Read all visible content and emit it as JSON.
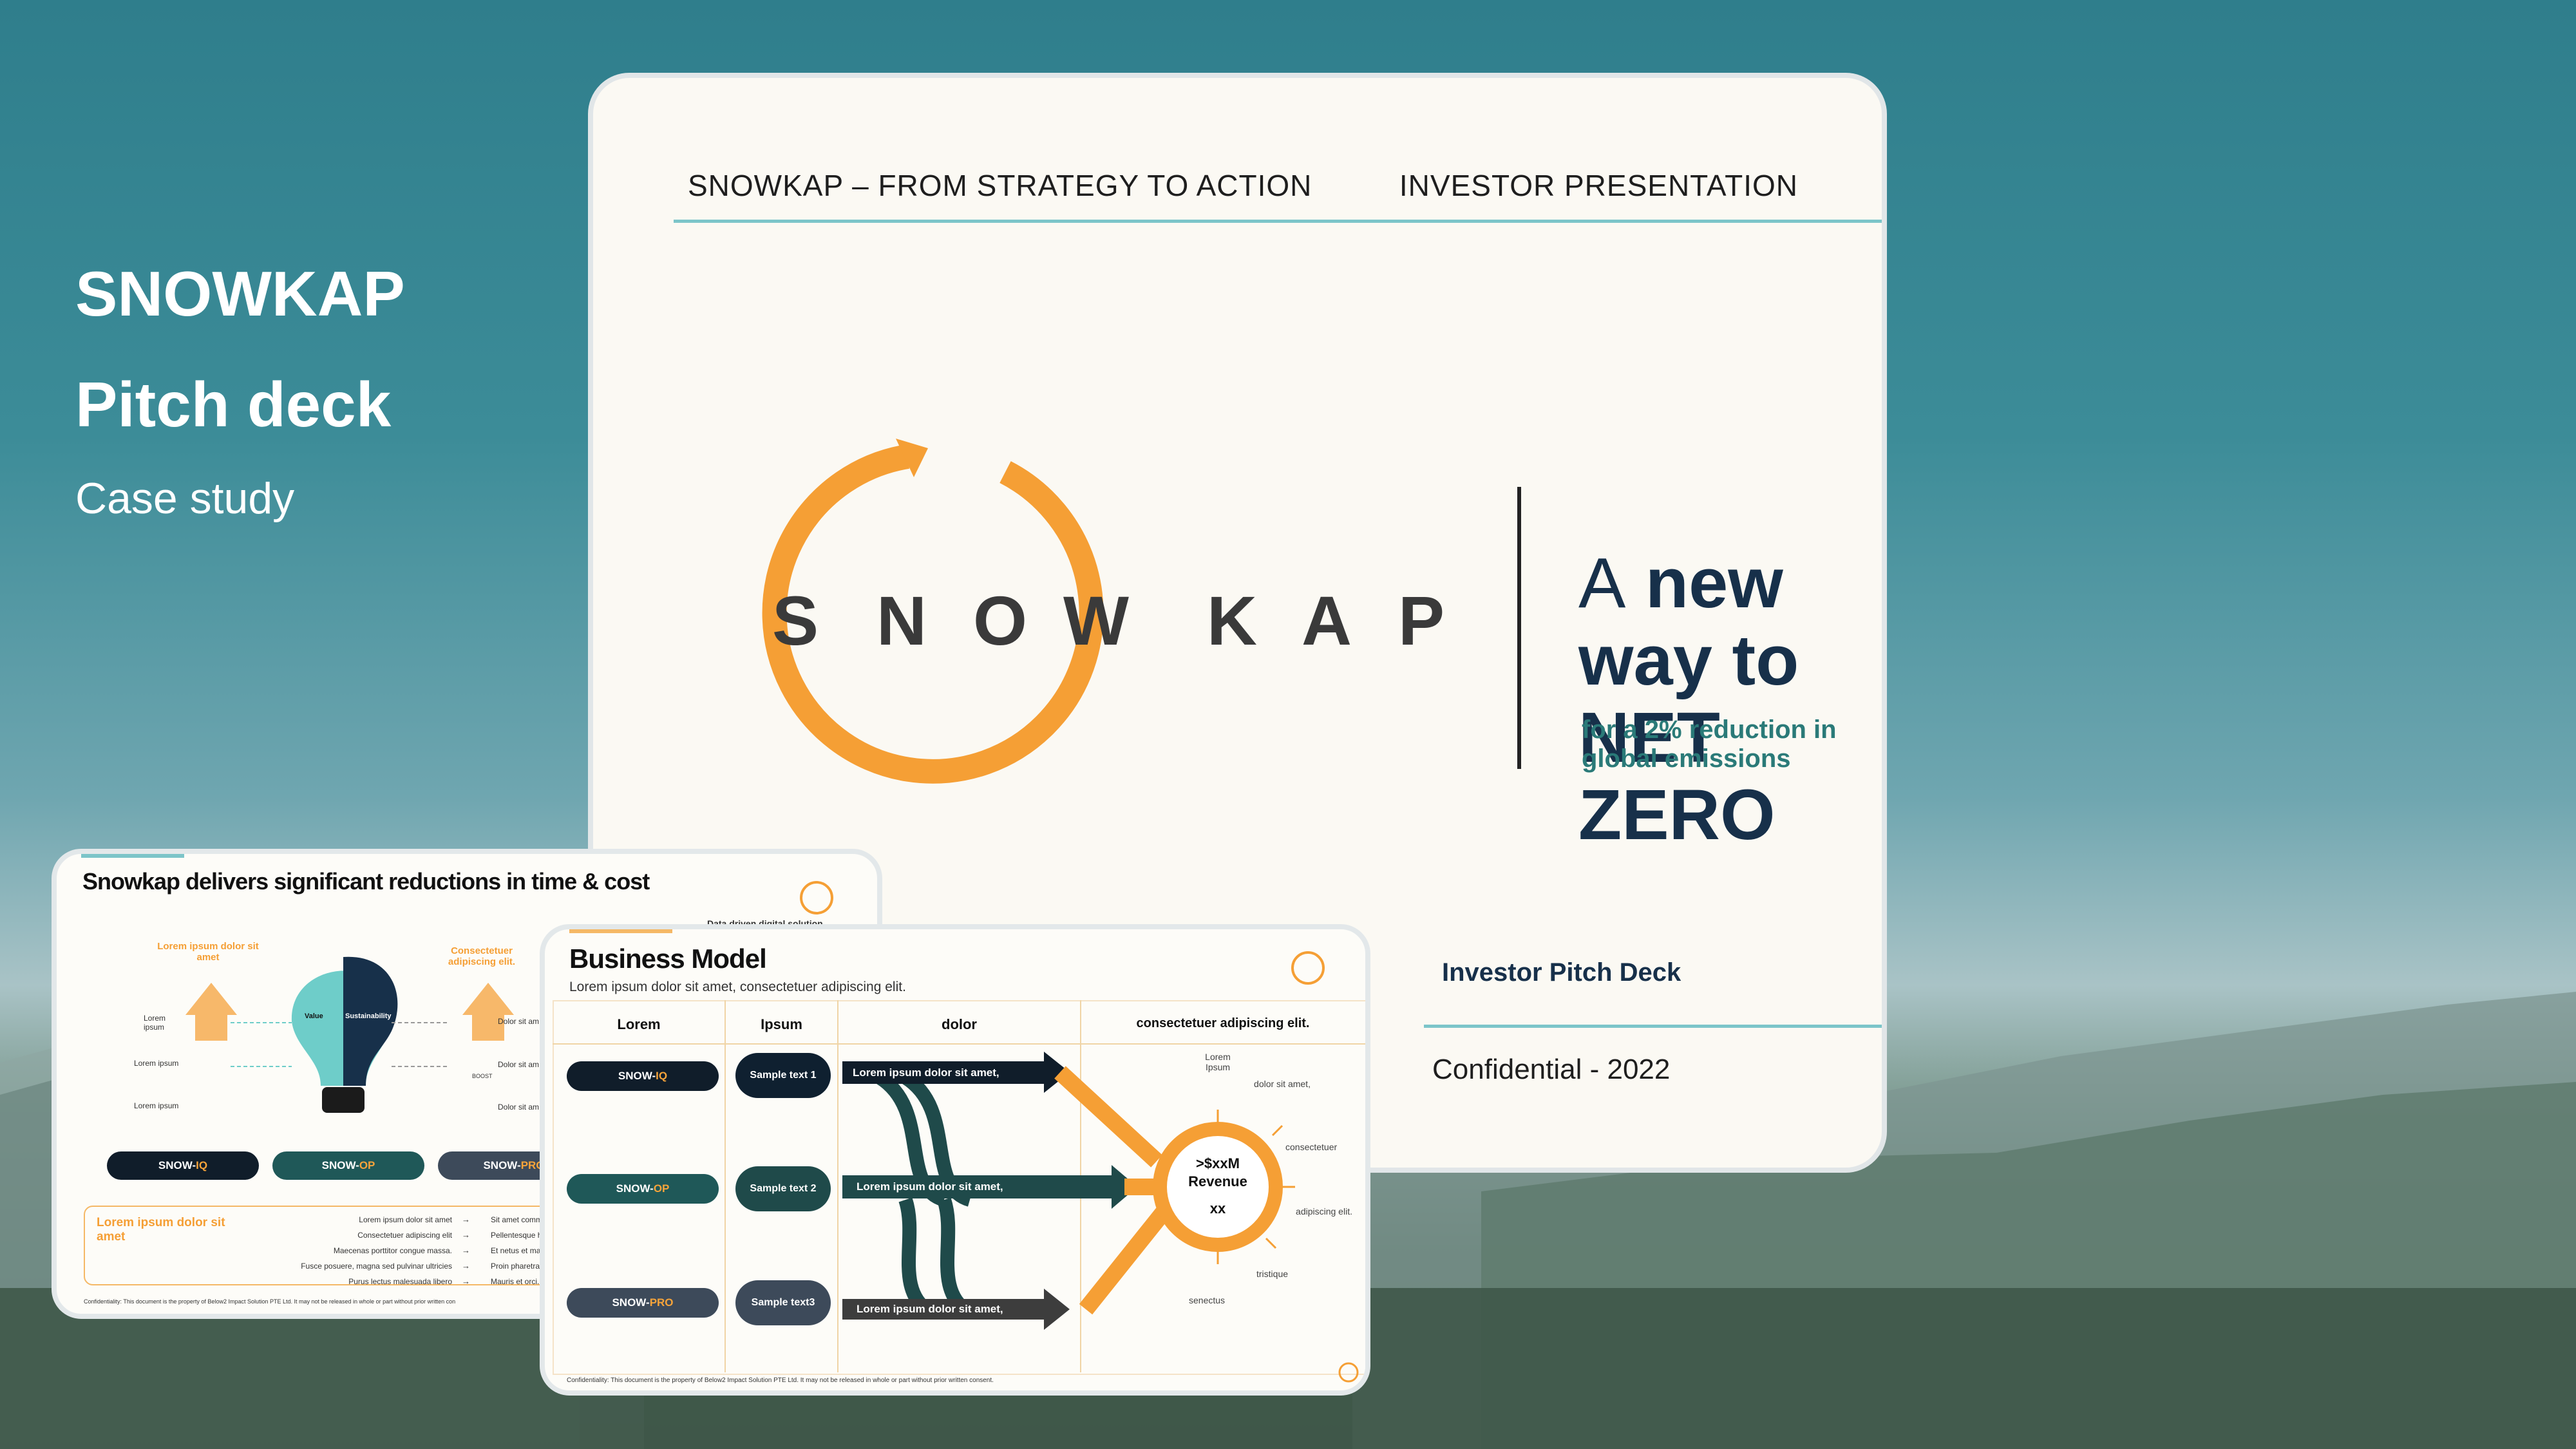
{
  "hero": {
    "title_line1": "SNOWKAP",
    "title_line2": "Pitch deck",
    "subtitle": "Case study"
  },
  "main_slide": {
    "header_left": "SNOWKAP –  FROM STRATEGY TO ACTION",
    "header_right": "INVESTOR PRESENTATION",
    "logo_letters": [
      "S",
      "N",
      "O",
      "W",
      "K",
      "A",
      "P"
    ],
    "tagline_a": "A",
    "tagline_rest_1": " new way to NET",
    "tagline_line2": "ZERO",
    "tagline_sub": "for a 2% reduction in global emissions",
    "footer_title": "Investor Pitch Deck",
    "confidential": "Confidential - 2022",
    "accent_orange": "#f59f35",
    "accent_teal": "#7cc5c9"
  },
  "slide_reductions": {
    "title": "Snowkap delivers significant reductions in time & cost",
    "top_right_text": "Data driven digital solution",
    "left_arrow_label": "Lorem ipsum dolor sit amet",
    "right_arrow_label": "Consectetuer adipiscing elit.",
    "left_items": [
      "Lorem ipsum",
      "Lorem ipsum",
      "Lorem ipsum"
    ],
    "right_items": [
      "Dolor sit am",
      "Dolor sit am",
      "Dolor sit am"
    ],
    "bulb_left": "Value",
    "bulb_right": "Sustainability",
    "boost_label": "BOOST",
    "pills": [
      {
        "prefix": "SNOW-",
        "suffix": "IQ"
      },
      {
        "prefix": "SNOW-",
        "suffix": "OP"
      },
      {
        "prefix": "SNOW-",
        "suffix": "PRO"
      }
    ],
    "box_heading": "Lorem ipsum dolor sit amet",
    "box_left": [
      "Lorem ipsum dolor sit amet",
      "Consectetuer adipiscing elit",
      "Maecenas porttitor congue massa.",
      "Fusce posuere, magna sed pulvinar ultricies",
      "Purus lectus malesuada libero"
    ],
    "box_right": [
      "Sit amet commodo m",
      "Pellentesque habita",
      "Et netus et malesua",
      "Proin pharetra nonu",
      "Mauris et orci."
    ],
    "arrow_glyph": "→",
    "footer": "Confidentiality: This document is the property of Below2 Impact Solution PTE Ltd. It may not be released in whole or part without prior written con"
  },
  "slide_business": {
    "title": "Business Model",
    "subtitle": "Lorem ipsum dolor sit amet, consectetuer adipiscing elit.",
    "columns": [
      "Lorem",
      "Ipsum",
      "dolor",
      "consectetuer adipiscing elit."
    ],
    "pills": [
      {
        "prefix": "SNOW-",
        "suffix": "IQ"
      },
      {
        "prefix": "SNOW-",
        "suffix": "OP"
      },
      {
        "prefix": "SNOW-",
        "suffix": "PRO"
      }
    ],
    "samples": [
      "Sample text 1",
      "Sample text 2",
      "Sample text3"
    ],
    "flows": [
      "Lorem ipsum dolor sit amet,",
      "Lorem ipsum dolor sit amet,",
      "Lorem ipsum dolor sit amet,"
    ],
    "revenue_line1": ">$xxM",
    "revenue_line2": "Revenue",
    "revenue_line3": "xx",
    "outer_labels": [
      "Lorem Ipsum",
      "dolor sit amet,",
      "consectetuer",
      "adipiscing elit.",
      "tristique",
      "senectus"
    ],
    "footer": "Confidentiality: This document is the property of Below2 Impact Solution PTE Ltd. It may not be released in whole or part without prior written consent."
  }
}
